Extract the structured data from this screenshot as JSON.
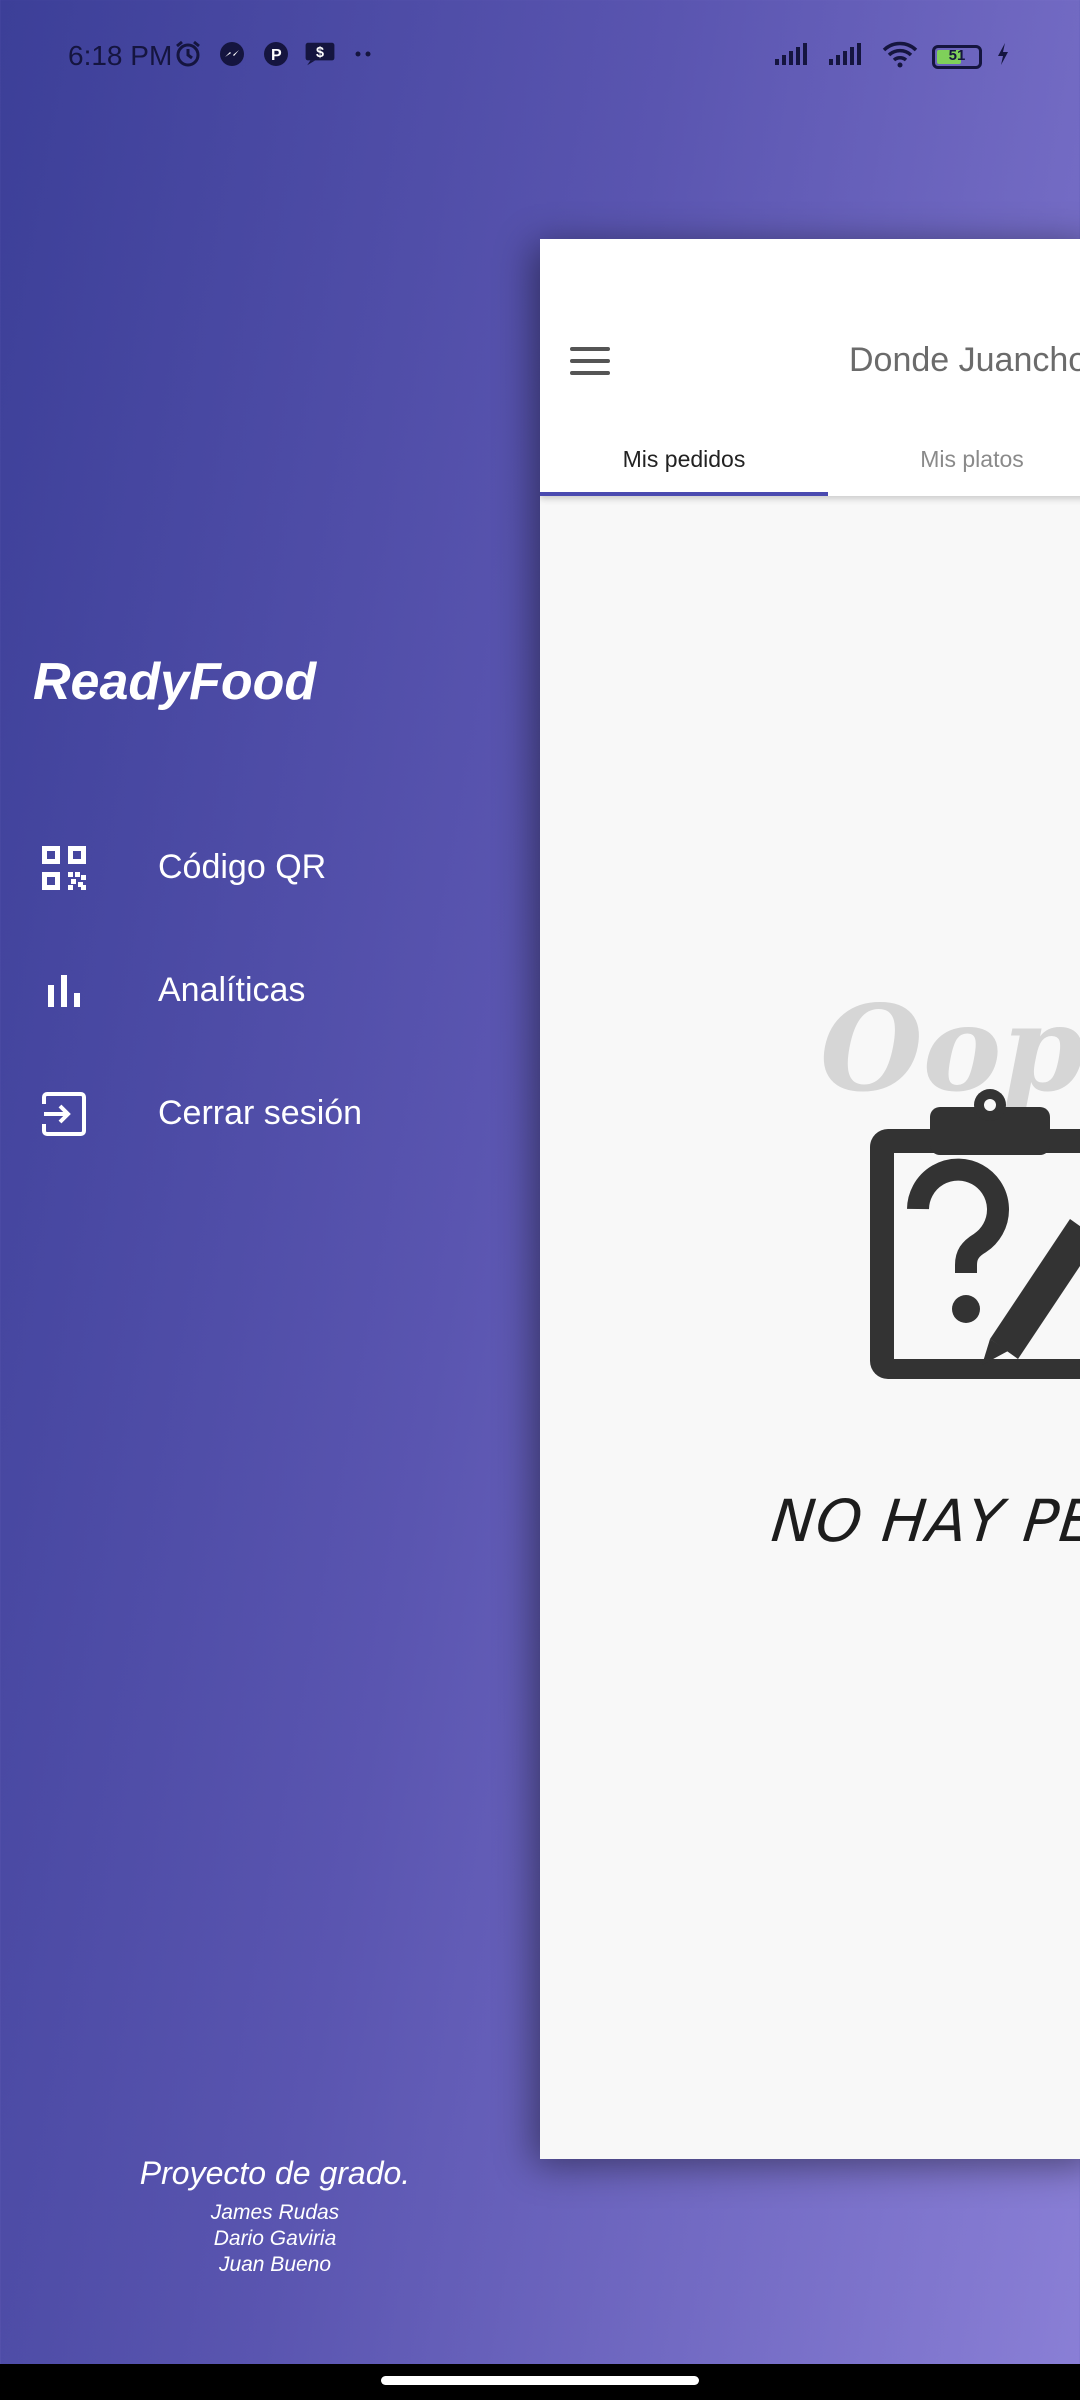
{
  "status_bar": {
    "time": "6:18 PM",
    "left_icons": [
      "alarm-icon",
      "messenger-icon",
      "app-p-icon",
      "chat-dollar-icon",
      "more-dots-icon"
    ],
    "right_icons": [
      "signal-icon",
      "signal-icon",
      "wifi-icon",
      "battery-icon",
      "charging-icon"
    ],
    "battery_level": "51"
  },
  "drawer": {
    "title": "ReadyFood",
    "items": [
      {
        "label": "Código QR",
        "icon": "qr-code-icon"
      },
      {
        "label": "Analíticas",
        "icon": "bar-chart-icon"
      },
      {
        "label": "Cerrar sesión",
        "icon": "logout-icon"
      }
    ],
    "credits": {
      "title": "Proyecto de grado.",
      "names": [
        "James Rudas",
        "Dario Gaviria",
        "Juan Bueno"
      ]
    }
  },
  "app_preview": {
    "title": "Donde Juancho",
    "tabs": [
      {
        "label": "Mis pedidos",
        "active": true
      },
      {
        "label": "Mis platos",
        "active": false
      }
    ],
    "empty_state": {
      "heading": "Oops",
      "message": "NO HAY PEDIDOS",
      "icon": "clipboard-question-icon"
    }
  },
  "colors": {
    "gradient_start": "#3c3f98",
    "gradient_end": "#8a7fd6",
    "tab_indicator": "#4a4ab0"
  }
}
